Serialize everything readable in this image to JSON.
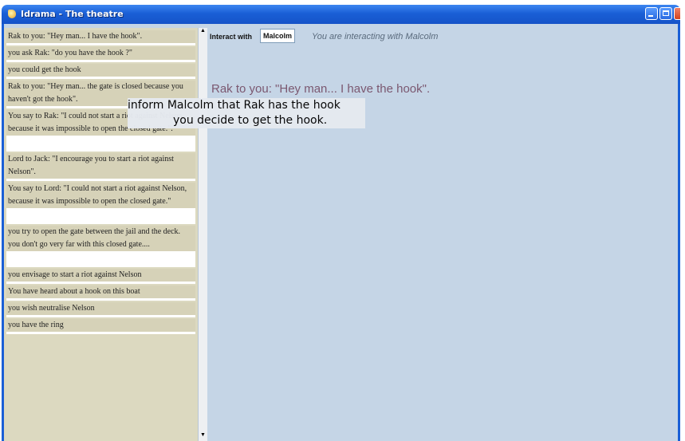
{
  "window": {
    "title": "Idrama - The theatre"
  },
  "history": [
    "Rak to you: \"Hey man... I have the hook\".",
    "you ask Rak: \"do you have the hook ?\"",
    "you could get the hook",
    "Rak to you: \"Hey man... the gate is closed because you haven't got the hook\".",
    "You say to Rak: \"I could not start a riot against Nelson, because it was impossible to open the closed gate.\".",
    "Lord to Jack: \"I encourage you to start a riot against Nelson\".",
    "You say to Lord: \"I could not start a riot against Nelson, because it was impossible to open the closed gate.\"",
    "you try to open the gate between the jail and the deck. you don't go very far with this closed gate....",
    "you envisage to start a riot against Nelson",
    "You have heard about a hook on this boat",
    "you wish neutralise Nelson",
    "you have the ring"
  ],
  "interact": {
    "label": "Interact with",
    "target": "Malcolm",
    "status": "You are interacting with Malcolm"
  },
  "speech": "Rak to you: \"Hey man... I have the hook\".",
  "menu": [
    "inform Malcolm that Rak has the hook",
    "you decide to get the hook."
  ],
  "colors": {
    "titlebar": "#1a5fd6",
    "panel": "#c5d5e6",
    "history_bg": "#d6d2b8",
    "speech": "#7b5870"
  }
}
